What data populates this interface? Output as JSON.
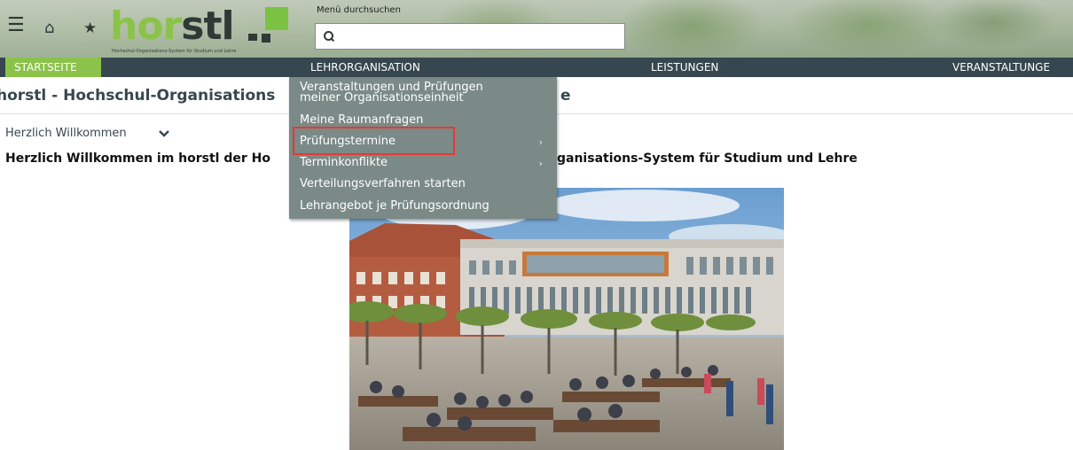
{
  "header": {
    "logo_word_a": "hor",
    "logo_word_b": "stl",
    "logo_tagline": "Hochschul-Organisations-System für Studium und Lehre",
    "search_label": "Menü durchsuchen",
    "search_value": "",
    "icons": [
      "menu-icon",
      "home-icon",
      "star-icon",
      "search-icon"
    ]
  },
  "nav": {
    "startseite": "STARTSEITE",
    "lehrorganisation": "LEHRORGANISATION",
    "leistungen": "LEISTUNGEN",
    "veranstaltungen": "VERANSTALTUNGE"
  },
  "dropdown": {
    "items": [
      {
        "label_line1": "Veranstaltungen und Prüfungen",
        "label_line2": "meiner Organisationseinheit"
      },
      {
        "label": "Meine Raumanfragen"
      },
      {
        "label": "Prüfungstermine",
        "has_submenu": true,
        "highlighted": true
      },
      {
        "label": "Terminkonflikte",
        "has_submenu": true
      },
      {
        "label": "Verteilungsverfahren starten"
      },
      {
        "label": "Lehrangebot je Prüfungsordnung"
      }
    ]
  },
  "main": {
    "title_visible": "horstl - Hochschul-Organisations",
    "title_suffix": "e",
    "welcome_toggle": "Herzlich Willkommen",
    "welcome_text_a": "Herzlich Willkommen im horstl der Ho",
    "welcome_text_b": "ganisations-System für Studium und Lehre"
  },
  "colors": {
    "nav_bg": "#37474f",
    "active_nav": "#8bc34a",
    "dropdown_bg": "#7b8a86",
    "highlight_border": "#e53935",
    "title": "#37474f"
  }
}
